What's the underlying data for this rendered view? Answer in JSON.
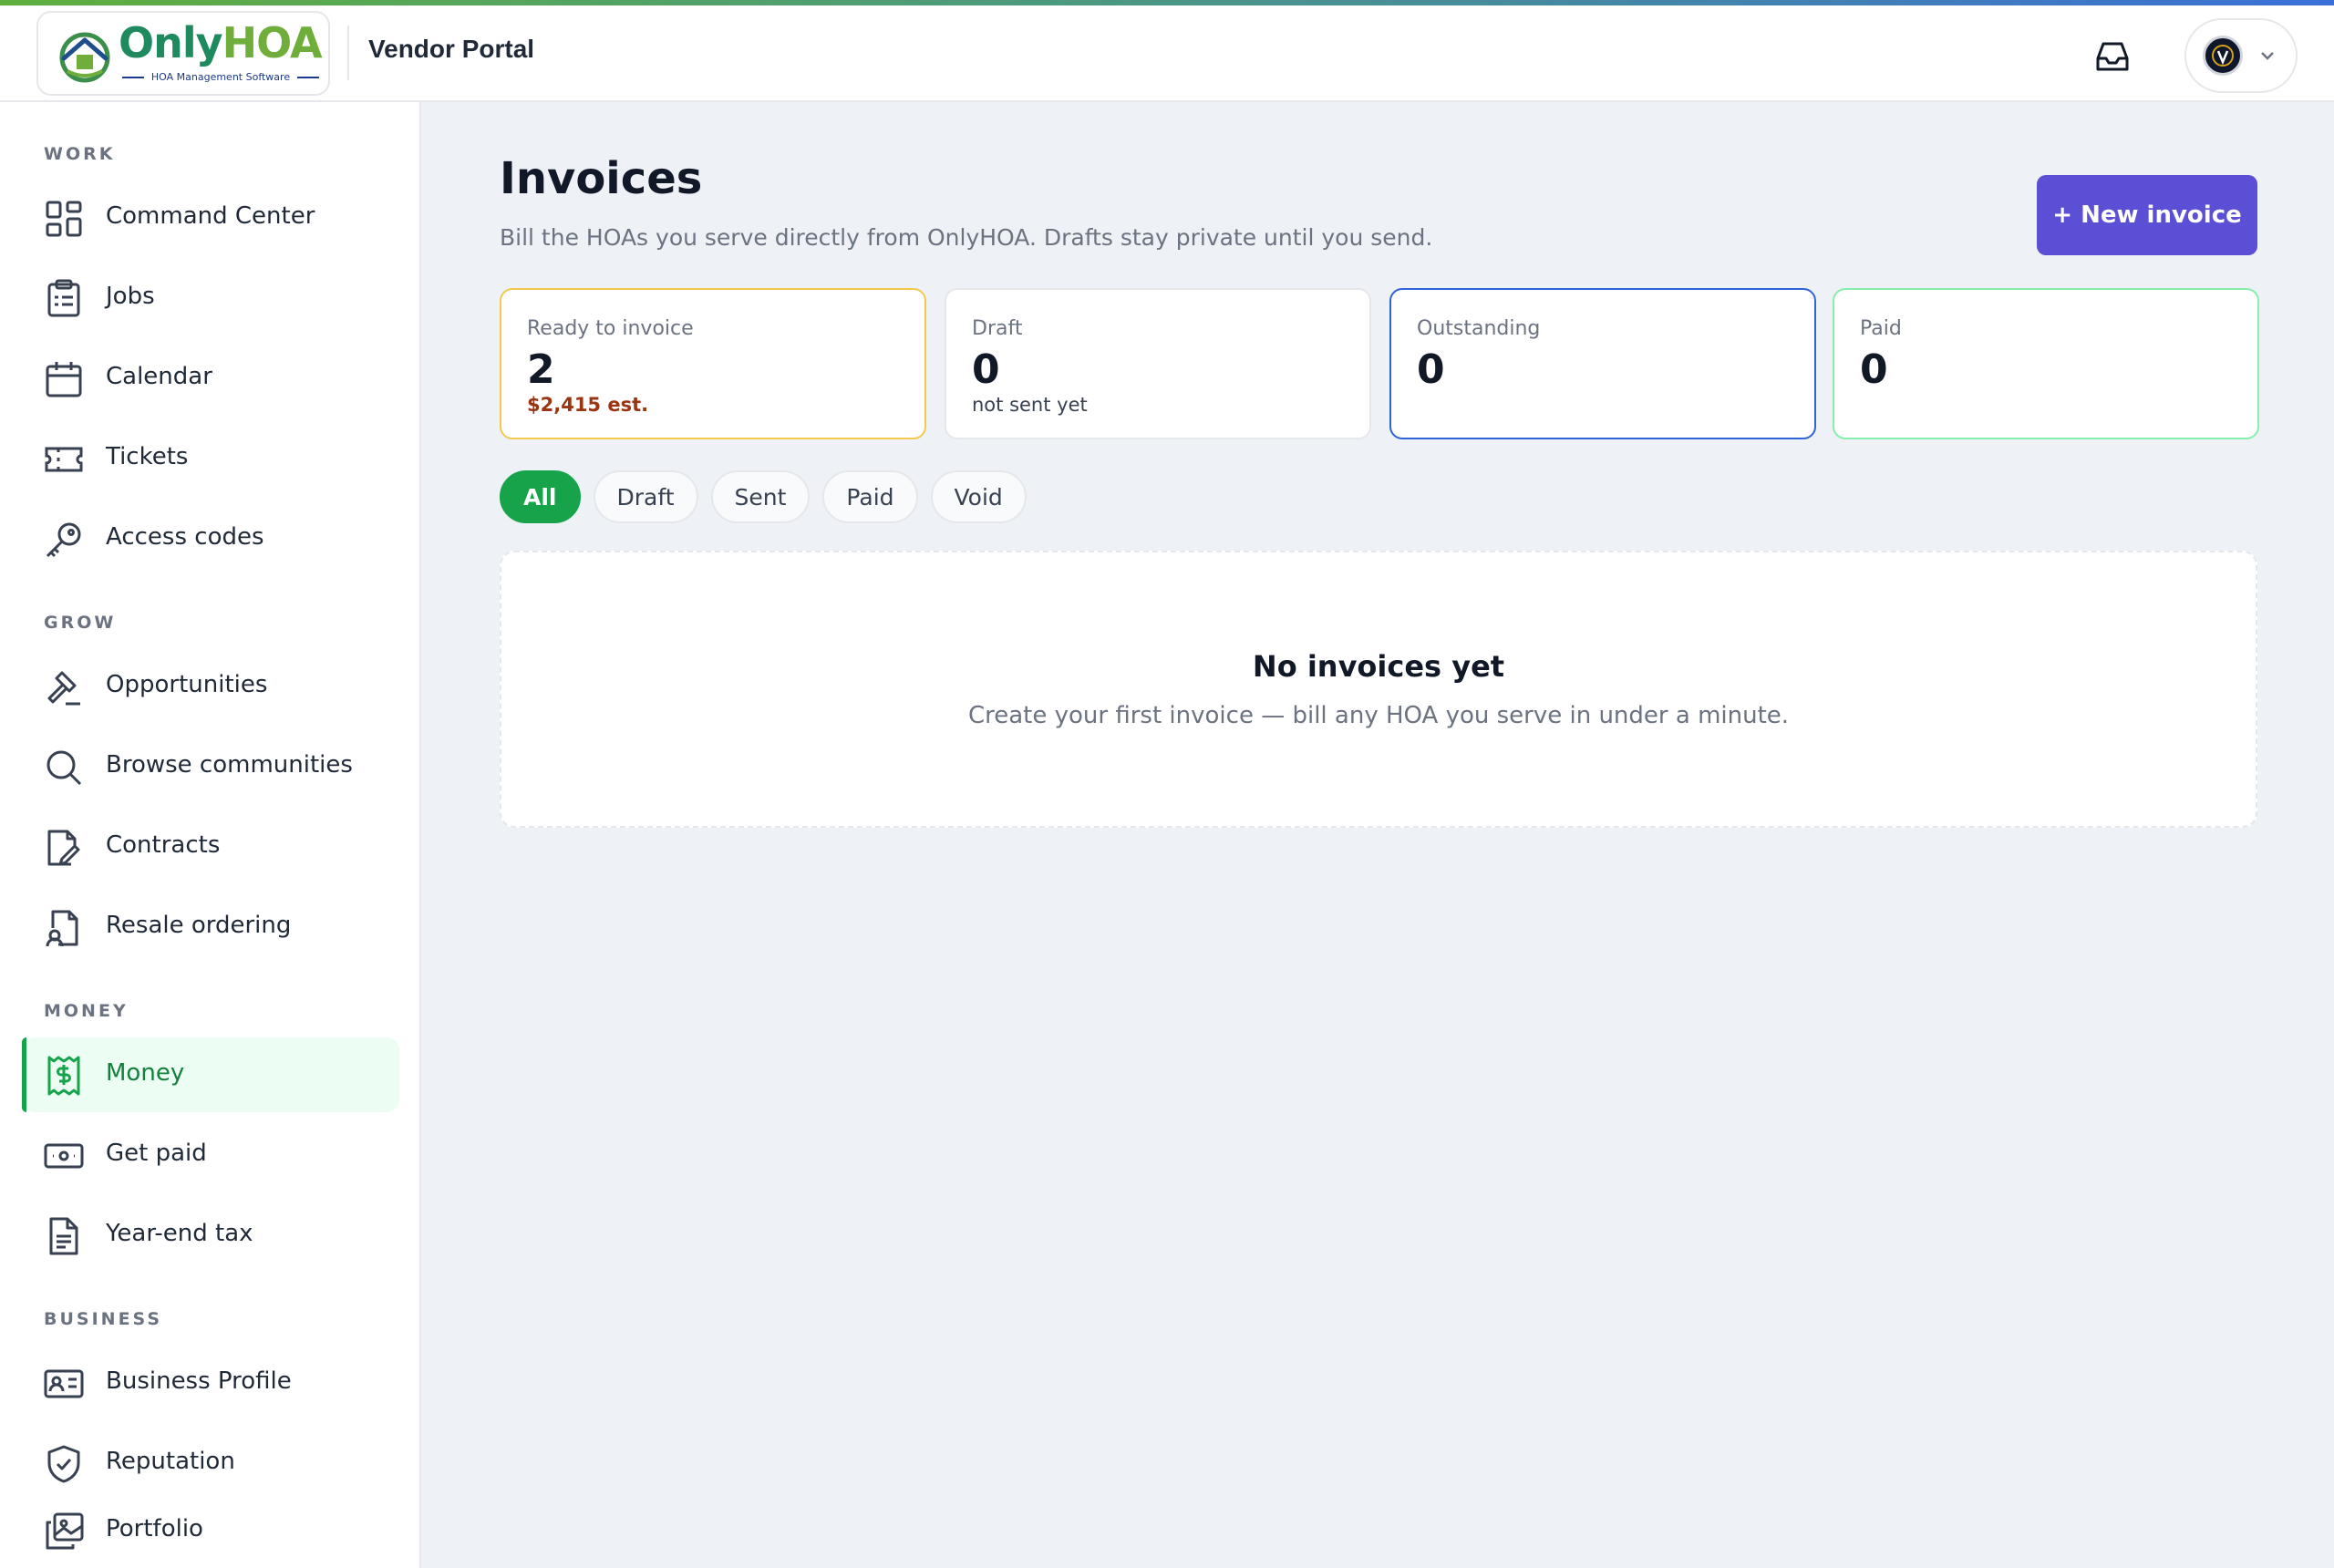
{
  "brand": {
    "name_part1": "Only",
    "name_part2": "HOA",
    "tagline": "HOA Management Software",
    "portal_title": "Vendor Portal",
    "colors": {
      "green": "#1f8a5e",
      "lime": "#6fae3a",
      "primary": "#5b4fd6",
      "success": "#16a34a"
    }
  },
  "header": {
    "inbox_icon": "inbox-icon",
    "avatar_icon": "vendor-avatar"
  },
  "sidebar": {
    "sections": [
      {
        "label": "WORK",
        "items": [
          {
            "label": "Command Center",
            "icon": "grid-icon"
          },
          {
            "label": "Jobs",
            "icon": "clipboard-icon"
          },
          {
            "label": "Calendar",
            "icon": "calendar-icon"
          },
          {
            "label": "Tickets",
            "icon": "ticket-icon"
          },
          {
            "label": "Access codes",
            "icon": "key-icon"
          }
        ]
      },
      {
        "label": "GROW",
        "items": [
          {
            "label": "Opportunities",
            "icon": "gavel-icon"
          },
          {
            "label": "Browse communities",
            "icon": "search-icon"
          },
          {
            "label": "Contracts",
            "icon": "document-edit-icon"
          },
          {
            "label": "Resale ordering",
            "icon": "document-user-icon"
          }
        ]
      },
      {
        "label": "MONEY",
        "items": [
          {
            "label": "Money",
            "icon": "receipt-dollar-icon",
            "active": true
          },
          {
            "label": "Get paid",
            "icon": "banknote-icon"
          },
          {
            "label": "Year-end tax",
            "icon": "file-text-icon"
          }
        ]
      },
      {
        "label": "BUSINESS",
        "items": [
          {
            "label": "Business Profile",
            "icon": "id-card-icon"
          },
          {
            "label": "Reputation",
            "icon": "shield-check-icon"
          },
          {
            "label": "Portfolio",
            "icon": "images-icon"
          }
        ]
      }
    ]
  },
  "page": {
    "title": "Invoices",
    "subtitle": "Bill the HOAs you serve directly from OnlyHOA. Drafts stay private until you send.",
    "new_button": "+ New invoice",
    "stats": [
      {
        "label": "Ready to invoice",
        "value": "2",
        "note": "$2,415 est."
      },
      {
        "label": "Draft",
        "value": "0",
        "note": "not sent yet"
      },
      {
        "label": "Outstanding",
        "value": "0",
        "note": ""
      },
      {
        "label": "Paid",
        "value": "0",
        "note": ""
      }
    ],
    "filters": [
      "All",
      "Draft",
      "Sent",
      "Paid",
      "Void"
    ],
    "active_filter": "All",
    "empty": {
      "title": "No invoices yet",
      "subtitle": "Create your first invoice — bill any HOA you serve in under a minute."
    }
  }
}
